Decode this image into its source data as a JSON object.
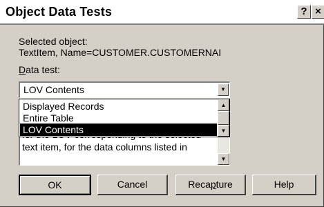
{
  "window": {
    "title": "Object Data Tests",
    "help_button": "?",
    "close_button": "×"
  },
  "selected": {
    "label": "Selected object:",
    "value": "TextItem, Name=CUSTOMER.CUSTOMERNAI"
  },
  "data_test": {
    "label_mnemonic": "D",
    "label_rest": "ata test:",
    "selected_value": "LOV Contents",
    "options": [
      "Displayed Records",
      "Entire Table",
      "LOV Contents"
    ],
    "selected_index": 2
  },
  "description": {
    "lines": [
      "for the LOV corresponding to the selected",
      "text item, for the data columns listed in"
    ]
  },
  "buttons": {
    "ok": "OK",
    "cancel": "Cancel",
    "recapture_pre": "Reca",
    "recapture_mnemonic": "p",
    "recapture_post": "ture",
    "help": "Help"
  },
  "icons": {
    "dropdown_arrow": "triangle-down-icon",
    "scroll_up": "triangle-up-icon",
    "scroll_down": "triangle-down-icon"
  }
}
